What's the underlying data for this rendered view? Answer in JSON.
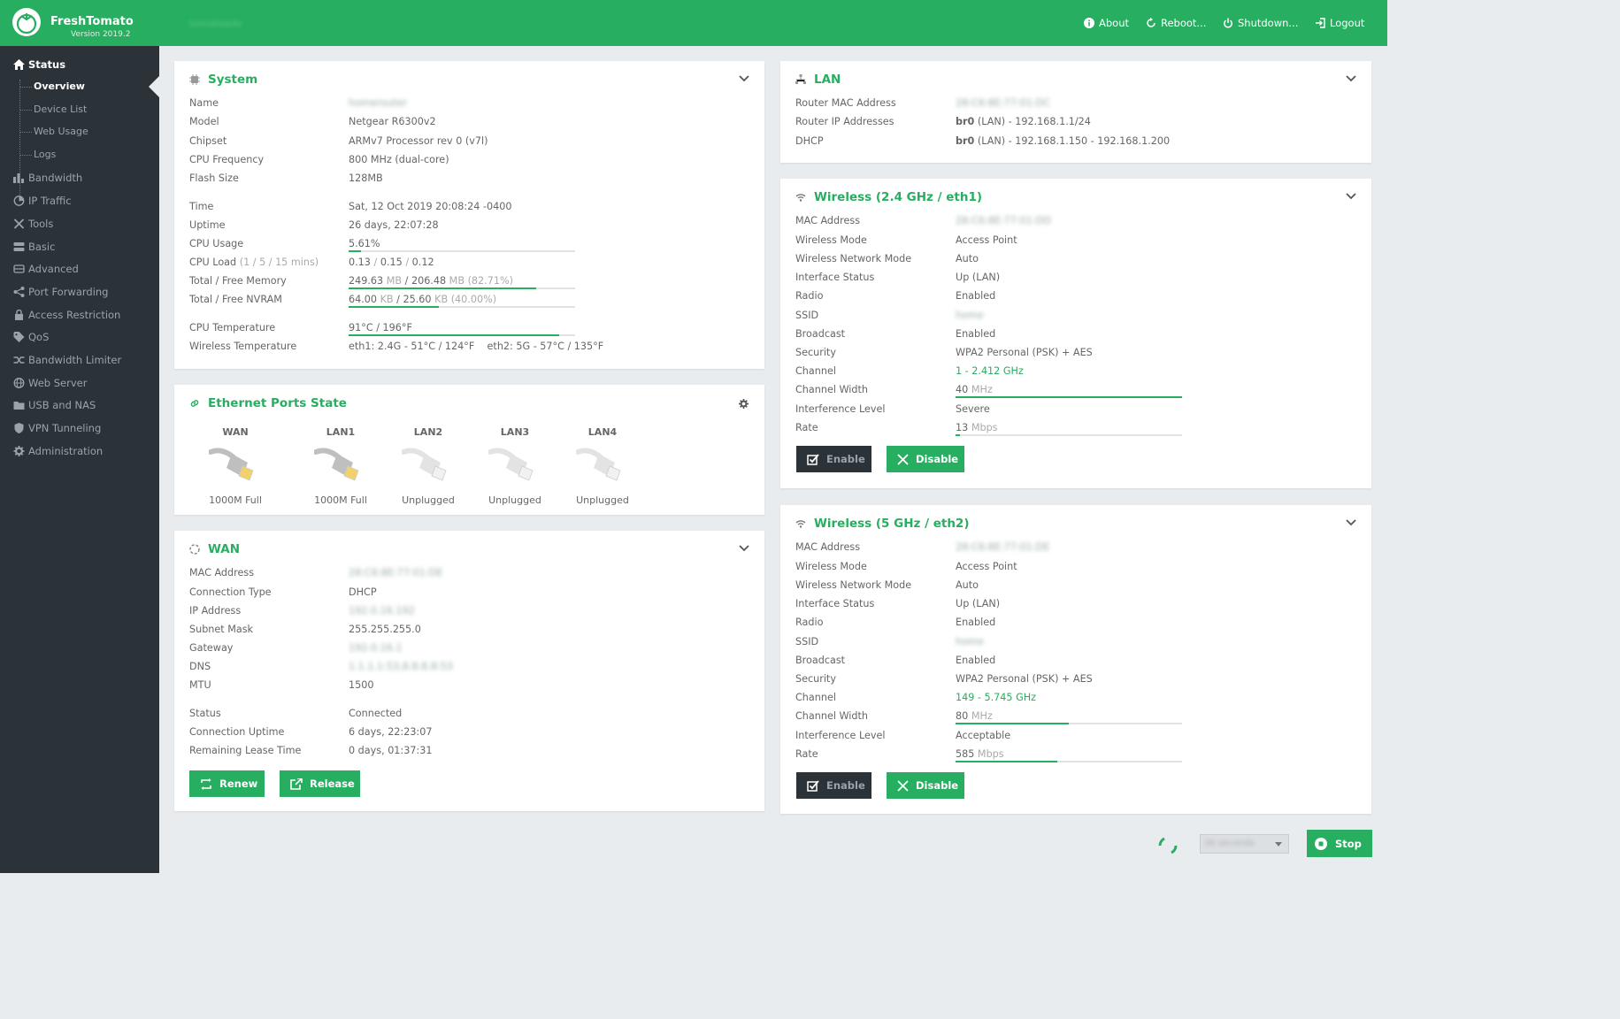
{
  "app": {
    "name": "FreshTomato",
    "version": "Version 2019.2",
    "hostname": "tomatoadv"
  },
  "topnav": {
    "about": "About",
    "reboot": "Reboot...",
    "shutdown": "Shutdown...",
    "logout": "Logout"
  },
  "sidebar": {
    "status": "Status",
    "sub": {
      "overview": "Overview",
      "device_list": "Device List",
      "web_usage": "Web Usage",
      "logs": "Logs"
    },
    "items": {
      "bandwidth": "Bandwidth",
      "ip_traffic": "IP Traffic",
      "tools": "Tools",
      "basic": "Basic",
      "advanced": "Advanced",
      "port_forwarding": "Port Forwarding",
      "access_restriction": "Access Restriction",
      "qos": "QoS",
      "bandwidth_limiter": "Bandwidth Limiter",
      "web_server": "Web Server",
      "usb_nas": "USB and NAS",
      "vpn": "VPN Tunneling",
      "administration": "Administration"
    }
  },
  "system": {
    "title": "System",
    "name": {
      "label": "Name",
      "value": "homerouter"
    },
    "model": {
      "label": "Model",
      "value": "Netgear R6300v2"
    },
    "chipset": {
      "label": "Chipset",
      "value": "ARMv7 Processor rev 0 (v7l)"
    },
    "cpu_freq": {
      "label": "CPU Frequency",
      "value": "800 MHz (dual-core)"
    },
    "flash": {
      "label": "Flash Size",
      "value": "128MB"
    },
    "time": {
      "label": "Time",
      "value": "Sat, 12 Oct 2019 20:08:24 -0400"
    },
    "uptime": {
      "label": "Uptime",
      "value": "26 days, 22:07:28"
    },
    "cpu_usage": {
      "label": "CPU Usage",
      "value": "5.61%",
      "fraction": 0.0561
    },
    "cpu_load": {
      "label": "CPU Load",
      "label_muted": "(1 / 5 / 15 mins)",
      "v1": "0.13",
      "sep": "/",
      "v2": "0.15",
      "v3": "0.12"
    },
    "memory": {
      "label": "Total / Free Memory",
      "total": "249.63",
      "unit": "MB",
      "sep": "/",
      "free": "206.48",
      "pct": "(82.71%)",
      "fraction": 0.8271
    },
    "nvram": {
      "label": "Total / Free NVRAM",
      "total": "64.00",
      "unit": "KB",
      "sep": "/",
      "free": "25.60",
      "pct": "(40.00%)",
      "fraction": 0.4
    },
    "cpu_temp": {
      "label": "CPU Temperature",
      "value": "91°C / 196°F",
      "fraction": 0.93
    },
    "wl_temp": {
      "label": "Wireless Temperature",
      "value": "eth1: 2.4G - 51°C / 124°F    eth2: 5G - 57°C / 135°F"
    }
  },
  "ethernet": {
    "title": "Ethernet Ports State",
    "ports": [
      {
        "name": "WAN",
        "status": "1000M Full",
        "connected": true
      },
      {
        "name": "LAN1",
        "status": "1000M Full",
        "connected": true
      },
      {
        "name": "LAN2",
        "status": "Unplugged",
        "connected": false
      },
      {
        "name": "LAN3",
        "status": "Unplugged",
        "connected": false
      },
      {
        "name": "LAN4",
        "status": "Unplugged",
        "connected": false
      }
    ]
  },
  "wan": {
    "title": "WAN",
    "mac": {
      "label": "MAC Address",
      "value": "28:C6:8E:77:01:DE"
    },
    "conn_type": {
      "label": "Connection Type",
      "value": "DHCP"
    },
    "ip": {
      "label": "IP Address",
      "value": "192.0.16.192"
    },
    "mask": {
      "label": "Subnet Mask",
      "value": "255.255.255.0"
    },
    "gateway": {
      "label": "Gateway",
      "value": "192.0.16.1"
    },
    "dns": {
      "label": "DNS",
      "value": "1.1.1.1:53,8.8.8.8:53"
    },
    "mtu": {
      "label": "MTU",
      "value": "1500"
    },
    "status": {
      "label": "Status",
      "value": "Connected"
    },
    "conn_uptime": {
      "label": "Connection Uptime",
      "value": "6 days, 22:23:07"
    },
    "lease": {
      "label": "Remaining Lease Time",
      "value": "0 days, 01:37:31"
    },
    "renew": "Renew",
    "release": "Release"
  },
  "lan": {
    "title": "LAN",
    "mac": {
      "label": "Router MAC Address",
      "value": "28:C6:8E:77:01:DC"
    },
    "ip": {
      "label": "Router IP Addresses",
      "iface": "br0",
      "value": "(LAN) - 192.168.1.1/24"
    },
    "dhcp": {
      "label": "DHCP",
      "iface": "br0",
      "value": "(LAN) - 192.168.1.150 - 192.168.1.200"
    }
  },
  "wl24": {
    "title": "Wireless (2.4 GHz / eth1)",
    "mac": {
      "label": "MAC Address",
      "value": "28:C6:8E:77:01:DD"
    },
    "mode": {
      "label": "Wireless Mode",
      "value": "Access Point"
    },
    "net_mode": {
      "label": "Wireless Network Mode",
      "value": "Auto"
    },
    "iface": {
      "label": "Interface Status",
      "value": "Up (LAN)"
    },
    "radio": {
      "label": "Radio",
      "value": "Enabled"
    },
    "ssid": {
      "label": "SSID",
      "value": "home"
    },
    "broadcast": {
      "label": "Broadcast",
      "value": "Enabled"
    },
    "security": {
      "label": "Security",
      "value": "WPA2 Personal (PSK) + AES"
    },
    "channel": {
      "label": "Channel",
      "value": "1 - 2.412 GHz"
    },
    "width": {
      "label": "Channel Width",
      "value": "40",
      "unit": "MHz",
      "fraction": 1.0
    },
    "interference": {
      "label": "Interference Level",
      "value": "Severe"
    },
    "rate": {
      "label": "Rate",
      "value": "13",
      "unit": "Mbps",
      "fraction": 0.02
    },
    "enable": "Enable",
    "disable": "Disable"
  },
  "wl5": {
    "title": "Wireless (5 GHz / eth2)",
    "mac": {
      "label": "MAC Address",
      "value": "28:C6:8E:77:01:DE"
    },
    "mode": {
      "label": "Wireless Mode",
      "value": "Access Point"
    },
    "net_mode": {
      "label": "Wireless Network Mode",
      "value": "Auto"
    },
    "iface": {
      "label": "Interface Status",
      "value": "Up (LAN)"
    },
    "radio": {
      "label": "Radio",
      "value": "Enabled"
    },
    "ssid": {
      "label": "SSID",
      "value": "home"
    },
    "broadcast": {
      "label": "Broadcast",
      "value": "Enabled"
    },
    "security": {
      "label": "Security",
      "value": "WPA2 Personal (PSK) + AES"
    },
    "channel": {
      "label": "Channel",
      "value": "149 - 5.745 GHz"
    },
    "width": {
      "label": "Channel Width",
      "value": "80",
      "unit": "MHz",
      "fraction": 0.5
    },
    "interference": {
      "label": "Interference Level",
      "value": "Acceptable"
    },
    "rate": {
      "label": "Rate",
      "value": "585",
      "unit": "Mbps",
      "fraction": 0.45
    },
    "enable": "Enable",
    "disable": "Disable"
  },
  "footer": {
    "refresh": "30 seconds",
    "stop": "Stop"
  },
  "colors": {
    "accent": "#27ae60",
    "sidebar": "#2c3338",
    "background": "#e9ecef"
  }
}
